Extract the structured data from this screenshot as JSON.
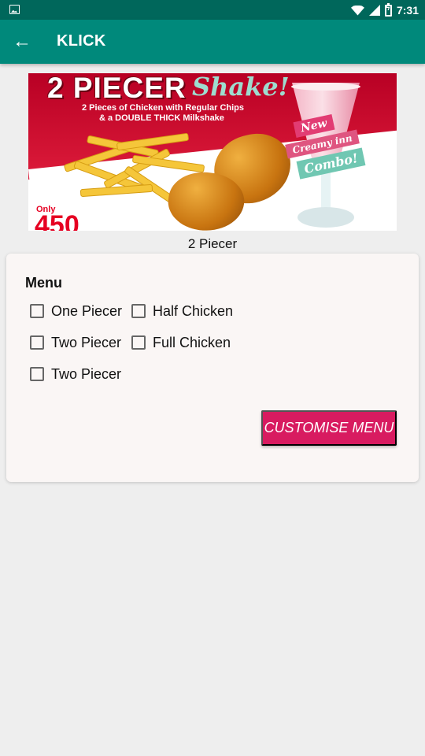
{
  "status_bar": {
    "time": "7:31",
    "icons": [
      "image-icon",
      "wifi-icon",
      "cellular-signal-icon",
      "battery-charging-icon"
    ]
  },
  "app_bar": {
    "title": "KLICK",
    "back_icon": "arrow-back-icon"
  },
  "banner": {
    "headline": "2 PIECER",
    "accent_text": "Shake!",
    "subtitle_line_1": "2 Pieces of Chicken with Regular Chips",
    "subtitle_line_2": "& a DOUBLE THICK Milkshake",
    "badge_new": "New",
    "badge_creamy": "Creamy inn",
    "badge_combo": "Combo!",
    "price_prefix": "Only",
    "price": "450"
  },
  "product": {
    "name": "2 Piecer"
  },
  "menu": {
    "title": "Menu",
    "options": [
      {
        "label": "One Piecer",
        "checked": false
      },
      {
        "label": "Half Chicken",
        "checked": false
      },
      {
        "label": "Two Piecer",
        "checked": false
      },
      {
        "label": "Full Chicken",
        "checked": false
      },
      {
        "label": "Two Piecer",
        "checked": false
      }
    ],
    "button_label": "CUSTOMISE MENU"
  },
  "colors": {
    "status_bar": "#00675b",
    "app_bar": "#00897b",
    "button": "#d81b60",
    "card": "#faf6f5",
    "background": "#eeeeee"
  }
}
